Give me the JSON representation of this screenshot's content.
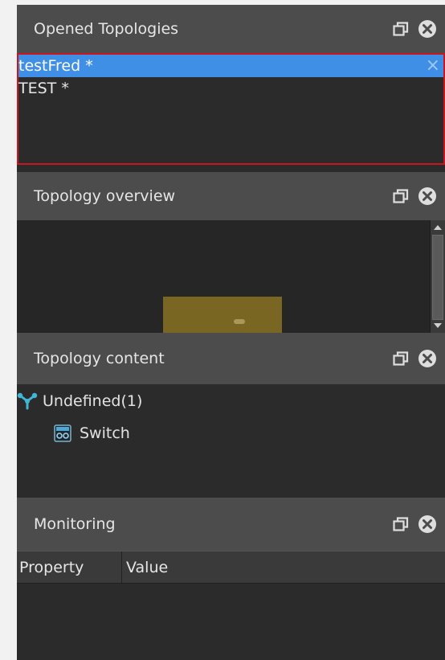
{
  "panels": {
    "opened_topologies": {
      "title": "Opened Topologies",
      "items": [
        {
          "label": "testFred *",
          "selected": true,
          "close_glyph": "×"
        },
        {
          "label": "TEST *",
          "selected": false
        }
      ]
    },
    "topology_overview": {
      "title": "Topology overview"
    },
    "topology_content": {
      "title": "Topology content",
      "tree": [
        {
          "label": "Undefined(1)",
          "icon": "topology-node-icon",
          "level": 0
        },
        {
          "label": "Switch",
          "icon": "switch-icon",
          "level": 1
        }
      ]
    },
    "monitoring": {
      "title": "Monitoring",
      "columns": [
        "Property",
        "Value"
      ]
    }
  },
  "icons": {
    "undock": "restore-window-icon",
    "close": "close-circle-icon"
  },
  "colors": {
    "selection": "#3f8fe6",
    "highlight_border": "#c8161e",
    "header_bg": "#4c4c4c",
    "panel_bg": "#2b2b2b",
    "overview_view_rect": "#7a6623",
    "topology_icon": "#3fb6d6"
  }
}
